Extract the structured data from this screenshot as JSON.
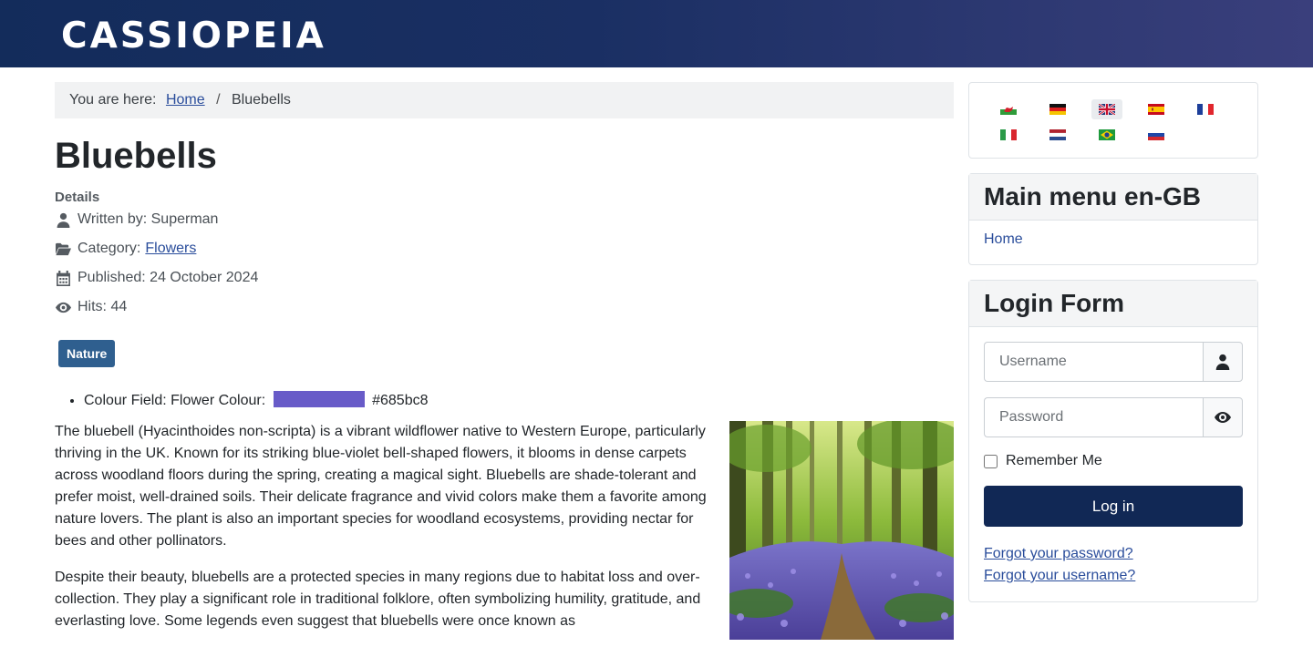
{
  "site": {
    "brand": "CASSIOPEIA"
  },
  "breadcrumb": {
    "prefix": "You are here:",
    "home": "Home",
    "separator": "/",
    "current": "Bluebells"
  },
  "article": {
    "title": "Bluebells",
    "details_label": "Details",
    "written_by": "Written by: Superman",
    "category_label": "Category:",
    "category": "Flowers",
    "published": "Published: 24 October 2024",
    "hits": "Hits: 44",
    "tag": "Nature",
    "colour_field_label": "Colour Field: Flower Colour:",
    "colour_value": "#685bc8",
    "paragraph_1": "The bluebell (Hyacinthoides non-scripta) is a vibrant wildflower native to Western Europe, particularly thriving in the UK. Known for its striking blue-violet bell-shaped flowers, it blooms in dense carpets across woodland floors during the spring, creating a magical sight. Bluebells are shade-tolerant and prefer moist, well-drained soils. Their delicate fragrance and vivid colors make them a favorite among nature lovers. The plant is also an important species for woodland ecosystems, providing nectar for bees and other pollinators.",
    "paragraph_2": "Despite their beauty, bluebells are a protected species in many regions due to habitat loss and over-collection. They play a significant role in traditional folklore, often symbolizing humility, gratitude, and everlasting love. Some legends even suggest that bluebells were once known as"
  },
  "languages": {
    "items": [
      {
        "code": "cy",
        "active": false
      },
      {
        "code": "de",
        "active": false
      },
      {
        "code": "en-gb",
        "active": true
      },
      {
        "code": "es",
        "active": false
      },
      {
        "code": "fr",
        "active": false
      },
      {
        "code": "it",
        "active": false
      },
      {
        "code": "nl",
        "active": false
      },
      {
        "code": "pt-br",
        "active": false
      },
      {
        "code": "ru",
        "active": false
      }
    ]
  },
  "main_menu": {
    "title": "Main menu en-GB",
    "items": [
      "Home"
    ]
  },
  "login": {
    "title": "Login Form",
    "username_placeholder": "Username",
    "password_placeholder": "Password",
    "remember": "Remember Me",
    "button": "Log in",
    "forgot_password": "Forgot your password?",
    "forgot_username": "Forgot your username?"
  },
  "colors": {
    "header_start": "#132c5b",
    "header_end": "#3a3f7c",
    "tag_bg": "#2f5f8f",
    "login_button": "#112855",
    "link": "#2a4d9b"
  },
  "icons": {
    "author": "user-icon",
    "category": "folder-open-icon",
    "published": "calendar-icon",
    "hits": "eye-icon",
    "username": "user-icon",
    "password": "eye-icon"
  }
}
